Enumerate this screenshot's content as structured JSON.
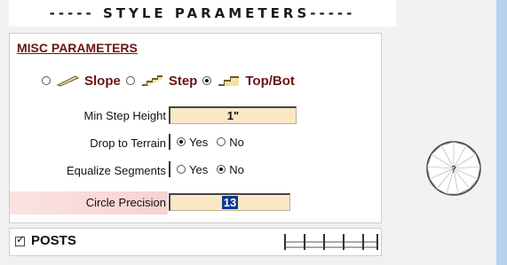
{
  "header": {
    "title": "----- STYLE PARAMETERS-----"
  },
  "misc": {
    "title": "MISC PARAMETERS",
    "modes": [
      {
        "label": "Slope",
        "selected": false,
        "icon": "slope-icon"
      },
      {
        "label": "Step",
        "selected": false,
        "icon": "step-icon"
      },
      {
        "label": "Top/Bot",
        "selected": true,
        "icon": "top-bot-icon"
      }
    ],
    "min_step_height": {
      "label": "Min Step Height",
      "value": "1\""
    },
    "drop_to_terrain": {
      "label": "Drop to Terrain",
      "yes": "Yes",
      "no": "No",
      "selected": "Yes"
    },
    "equalize_segments": {
      "label": "Equalize Segments",
      "yes": "Yes",
      "no": "No",
      "selected": "No"
    },
    "circle_precision": {
      "label": "Circle Precision",
      "value": "13"
    }
  },
  "posts": {
    "label": "POSTS",
    "checked": true,
    "icon": "fence-posts-icon"
  },
  "preview": {
    "symbol": "?",
    "icon": "polygon-preview-icon"
  },
  "colors": {
    "accent": "#6b1414",
    "field_bg": "#f9e8c3",
    "selection": "#0b3a8c",
    "side_strip": "#b7d0ee"
  }
}
